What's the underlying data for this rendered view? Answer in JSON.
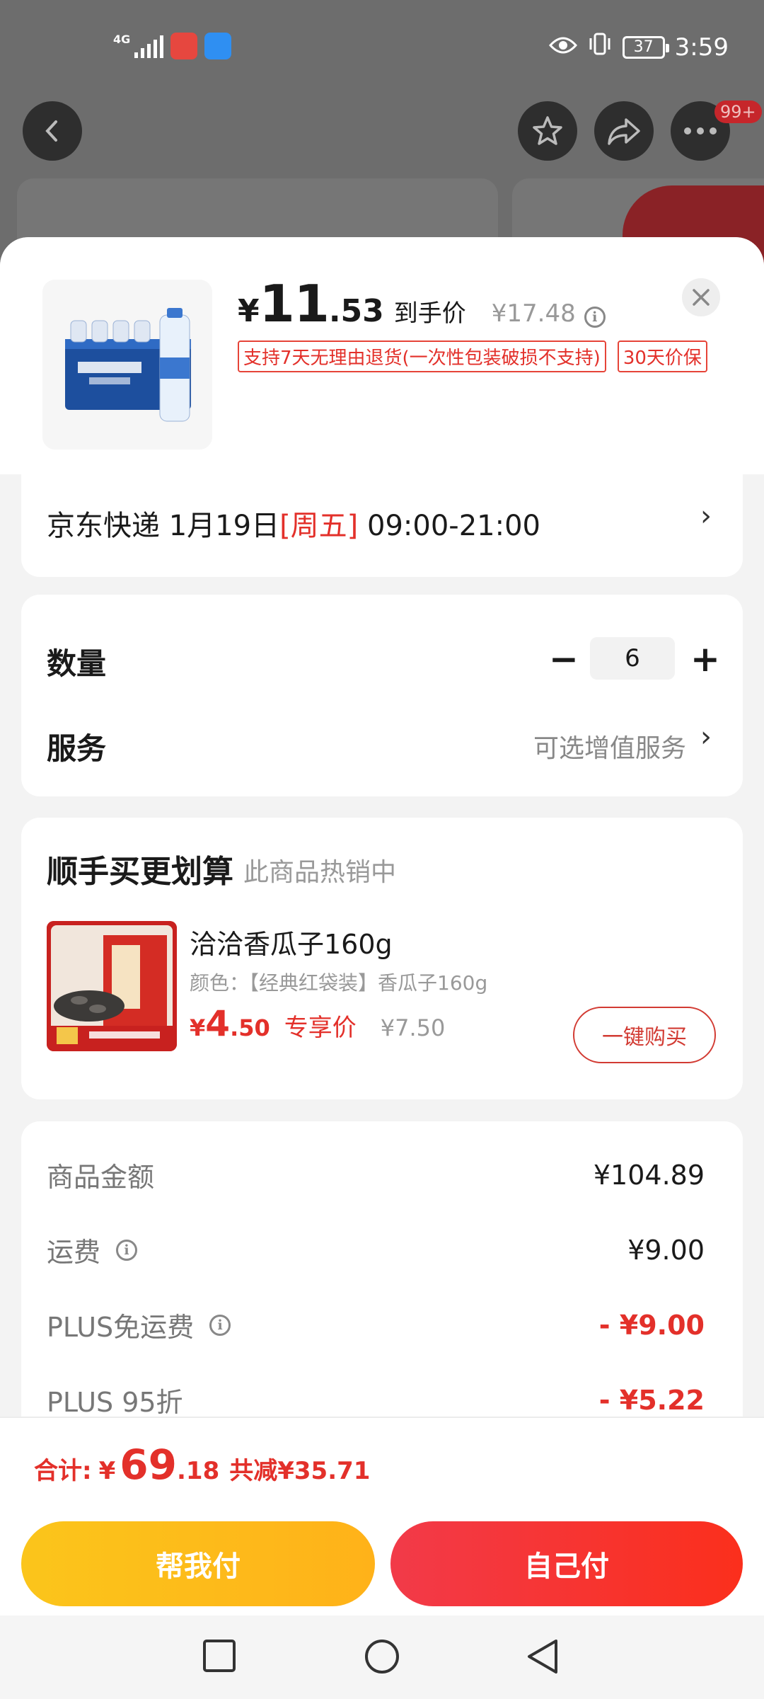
{
  "status_bar": {
    "network": "4G",
    "time": "3:59",
    "battery": "37"
  },
  "top_badge": "99+",
  "product": {
    "currency": "¥",
    "price_int": "11",
    "price_dec": ".53",
    "price_label": "到手价",
    "original_price": "¥17.48",
    "tags": [
      "支持7天无理由退货(一次性包装破损不支持)",
      "30天价保"
    ]
  },
  "delivery": {
    "carrier": "京东快递",
    "date": "1月19日",
    "weekday": "[周五]",
    "window": "09:00-21:00"
  },
  "quantity": {
    "label": "数量",
    "minus": "−",
    "plus": "+",
    "value": "6"
  },
  "service": {
    "label": "服务",
    "value": "可选增值服务"
  },
  "addon": {
    "title": "顺手买更划算",
    "subtitle": "此商品热销中",
    "name": "洽洽香瓜子160g",
    "spec": "颜色：【经典红袋装】香瓜子160g",
    "currency": "¥",
    "price_int": "4",
    "price_dec": ".50",
    "price_label": "专享价",
    "old_price": "¥7.50",
    "button": "一键购买"
  },
  "summary": {
    "rows": [
      {
        "label": "商品金额",
        "value": "¥104.89"
      },
      {
        "label": "运费",
        "value": "¥9.00"
      },
      {
        "label": "PLUS免运费",
        "value": "- ¥9.00"
      },
      {
        "label": "PLUS 95折",
        "value": "- ¥5.22"
      }
    ]
  },
  "total": {
    "label": "合计:",
    "currency": "¥",
    "int": "69",
    "dec": ".18",
    "saving": "共减¥35.71"
  },
  "actions": {
    "help_pay": "帮我付",
    "self_pay": "自己付"
  },
  "colors": {
    "accent_red": "#e3302a",
    "help_yellow": "#fbc51b",
    "pay_red": "#f23a49"
  }
}
